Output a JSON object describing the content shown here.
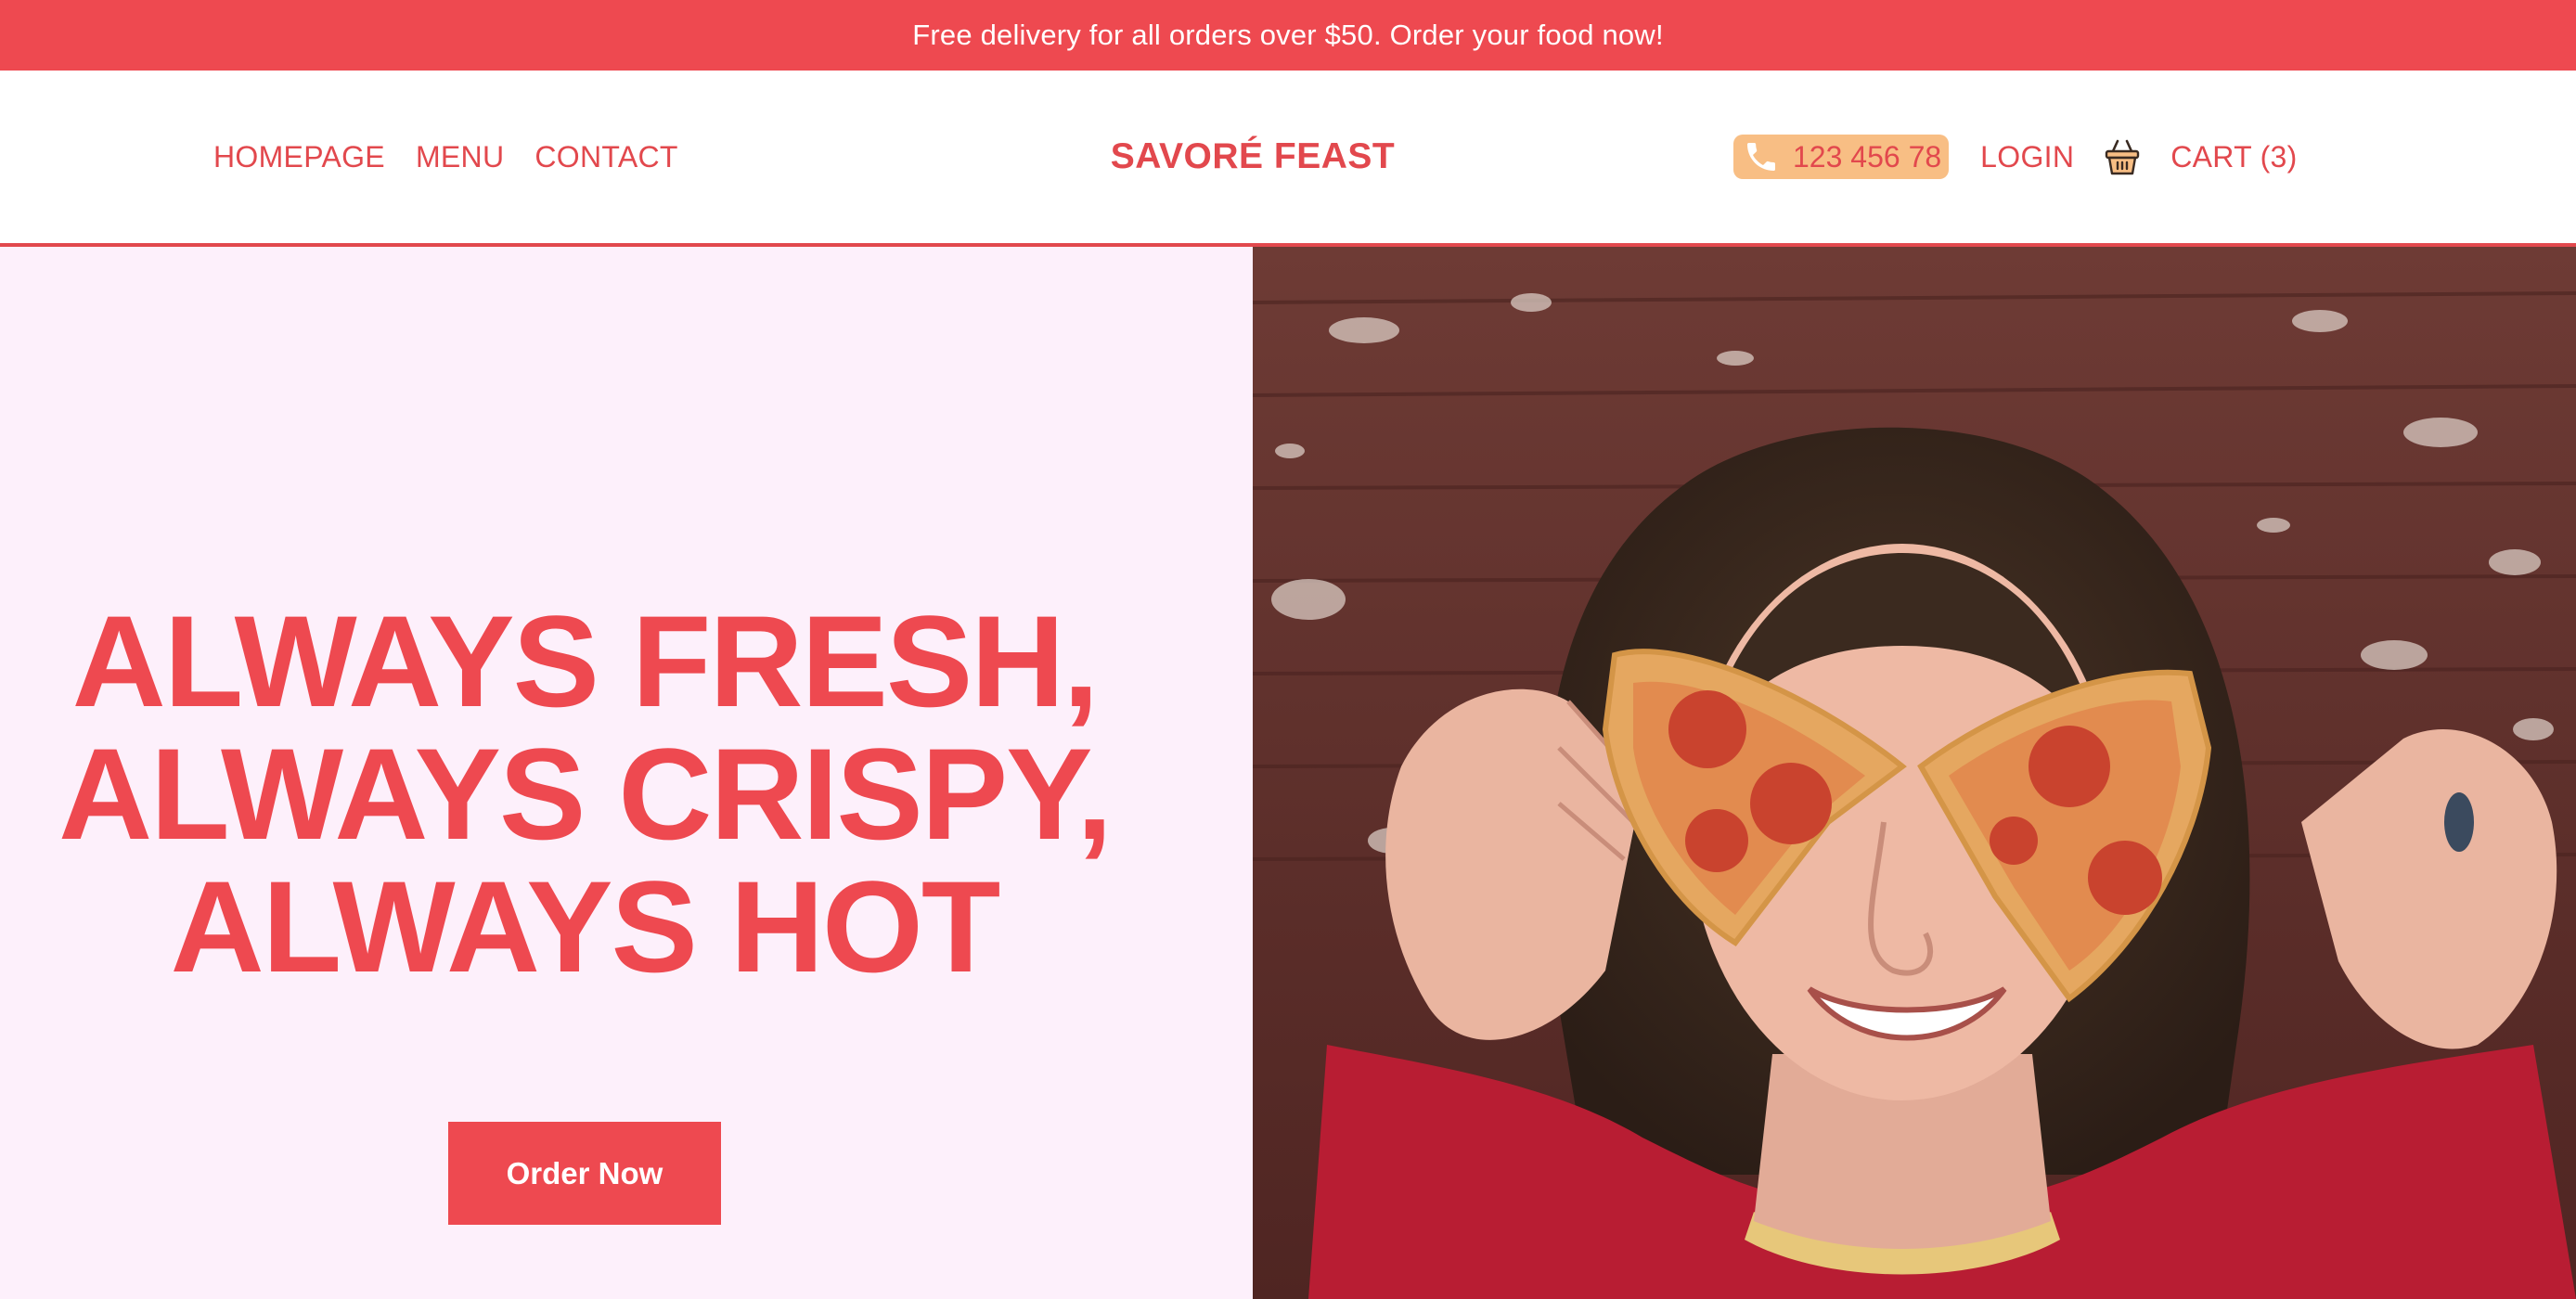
{
  "promo": {
    "text": "Free delivery for all orders over $50. Order your food now!"
  },
  "nav": {
    "left": [
      {
        "label": "HOMEPAGE"
      },
      {
        "label": "MENU"
      },
      {
        "label": "CONTACT"
      }
    ],
    "brand": "SAVORÉ FEAST",
    "phone": {
      "icon": "phone-icon",
      "number": "123 456 78"
    },
    "login_label": "LOGIN",
    "cart": {
      "icon": "basket-icon",
      "label": "CART (3)"
    }
  },
  "hero": {
    "headline": [
      "ALWAYS FRESH,",
      "ALWAYS CRISPY,",
      "ALWAYS HOT"
    ],
    "cta_label": "Order Now",
    "image": "hero-photo"
  },
  "colors": {
    "primary": "#ee4950",
    "hero_background": "#fdf0fb",
    "phone_pill": "#f8be84",
    "header_background": "#ffffff"
  }
}
